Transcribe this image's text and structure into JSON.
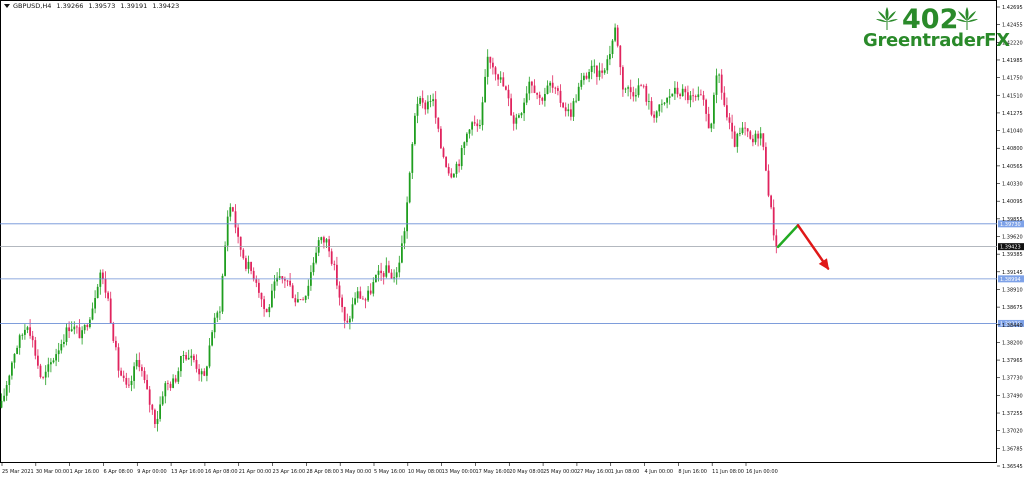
{
  "header": {
    "symbol": "GBPUSD,H4",
    "open": "1.39266",
    "high": "1.39573",
    "low": "1.39191",
    "close": "1.39423"
  },
  "logo": {
    "number": "402",
    "name": "GreentraderFX"
  },
  "colors": {
    "up": "#1f9e1f",
    "down": "#e0245e",
    "level_line": "#6b8fd6",
    "level_label": "#7ea2e8",
    "current_label": "#111111",
    "arrow_up": "#22aa22",
    "arrow_down": "#e01818"
  },
  "chart_data": {
    "type": "candlestick",
    "ylim": [
      1.3654,
      1.427
    ],
    "y_ticks": [
      "1.42695",
      "1.42455",
      "1.42220",
      "1.41985",
      "1.41750",
      "1.41510",
      "1.41275",
      "1.41040",
      "1.40800",
      "1.40565",
      "1.40330",
      "1.40095",
      "1.39855",
      "1.39620",
      "1.39385",
      "1.39145",
      "1.38910",
      "1.38675",
      "1.38440",
      "1.38200",
      "1.37965",
      "1.37730",
      "1.37490",
      "1.37255",
      "1.37020",
      "1.36785",
      "1.36545"
    ],
    "x_ticks": [
      "25 Mar 2021",
      "30 Mar 00:00",
      "1 Apr 16:00",
      "6 Apr 08:00",
      "9 Apr 00:00",
      "13 Apr 16:00",
      "16 Apr 08:00",
      "21 Apr 00:00",
      "23 Apr 16:00",
      "28 Apr 08:00",
      "3 May 00:00",
      "5 May 16:00",
      "10 May 08:00",
      "13 May 00:00",
      "17 May 16:00",
      "20 May 08:00",
      "25 May 00:00",
      "27 May 16:00",
      "1 Jun 08:00",
      "4 Jun 00:00",
      "8 Jun 16:00",
      "11 Jun 08:00",
      "16 Jun 00:00"
    ],
    "levels": [
      {
        "value": 1.3973,
        "label": "1.39730"
      },
      {
        "value": 1.3899,
        "label": "1.38994"
      },
      {
        "value": 1.3839,
        "label": "1.38376"
      }
    ],
    "current_price": {
      "value": 1.39423,
      "label": "1.39423"
    },
    "close_path": [
      [
        0,
        1.372
      ],
      [
        14,
        1.38
      ],
      [
        28,
        1.3842
      ],
      [
        42,
        1.376
      ],
      [
        56,
        1.38
      ],
      [
        70,
        1.3838
      ],
      [
        82,
        1.3822
      ],
      [
        92,
        1.386
      ],
      [
        100,
        1.391
      ],
      [
        108,
        1.3872
      ],
      [
        118,
        1.378
      ],
      [
        128,
        1.3745
      ],
      [
        138,
        1.3795
      ],
      [
        148,
        1.374
      ],
      [
        156,
        1.3705
      ],
      [
        164,
        1.3755
      ],
      [
        174,
        1.376
      ],
      [
        184,
        1.38
      ],
      [
        194,
        1.379
      ],
      [
        204,
        1.3762
      ],
      [
        212,
        1.383
      ],
      [
        220,
        1.3862
      ],
      [
        228,
        1.399
      ],
      [
        232,
        1.4
      ],
      [
        238,
        1.395
      ],
      [
        246,
        1.392
      ],
      [
        256,
        1.39
      ],
      [
        266,
        1.385
      ],
      [
        276,
        1.3895
      ],
      [
        286,
        1.39
      ],
      [
        296,
        1.387
      ],
      [
        306,
        1.388
      ],
      [
        318,
        1.395
      ],
      [
        328,
        1.395
      ],
      [
        336,
        1.39
      ],
      [
        346,
        1.383
      ],
      [
        356,
        1.388
      ],
      [
        366,
        1.387
      ],
      [
        376,
        1.39
      ],
      [
        386,
        1.391
      ],
      [
        396,
        1.39
      ],
      [
        404,
        1.396
      ],
      [
        410,
        1.404
      ],
      [
        416,
        1.414
      ],
      [
        424,
        1.413
      ],
      [
        432,
        1.4145
      ],
      [
        440,
        1.408
      ],
      [
        450,
        1.404
      ],
      [
        460,
        1.406
      ],
      [
        470,
        1.411
      ],
      [
        480,
        1.41
      ],
      [
        488,
        1.42
      ],
      [
        496,
        1.418
      ],
      [
        506,
        1.415
      ],
      [
        514,
        1.411
      ],
      [
        522,
        1.413
      ],
      [
        530,
        1.417
      ],
      [
        540,
        1.414
      ],
      [
        550,
        1.416
      ],
      [
        560,
        1.414
      ],
      [
        570,
        1.412
      ],
      [
        580,
        1.416
      ],
      [
        590,
        1.418
      ],
      [
        600,
        1.4175
      ],
      [
        608,
        1.4195
      ],
      [
        616,
        1.424
      ],
      [
        622,
        1.416
      ],
      [
        632,
        1.415
      ],
      [
        642,
        1.416
      ],
      [
        652,
        1.412
      ],
      [
        662,
        1.413
      ],
      [
        672,
        1.415
      ],
      [
        682,
        1.415
      ],
      [
        692,
        1.414
      ],
      [
        702,
        1.414
      ],
      [
        710,
        1.41
      ],
      [
        718,
        1.418
      ],
      [
        726,
        1.412
      ],
      [
        734,
        1.408
      ],
      [
        744,
        1.41
      ],
      [
        752,
        1.408
      ],
      [
        760,
        1.41
      ],
      [
        766,
        1.405
      ],
      [
        770,
        1.4
      ],
      [
        774,
        1.396
      ],
      [
        777,
        1.3942
      ]
    ],
    "projection": {
      "start": [
        778,
        1.3942
      ],
      "peak": [
        798,
        1.3971
      ],
      "end": [
        828,
        1.3913
      ]
    }
  }
}
